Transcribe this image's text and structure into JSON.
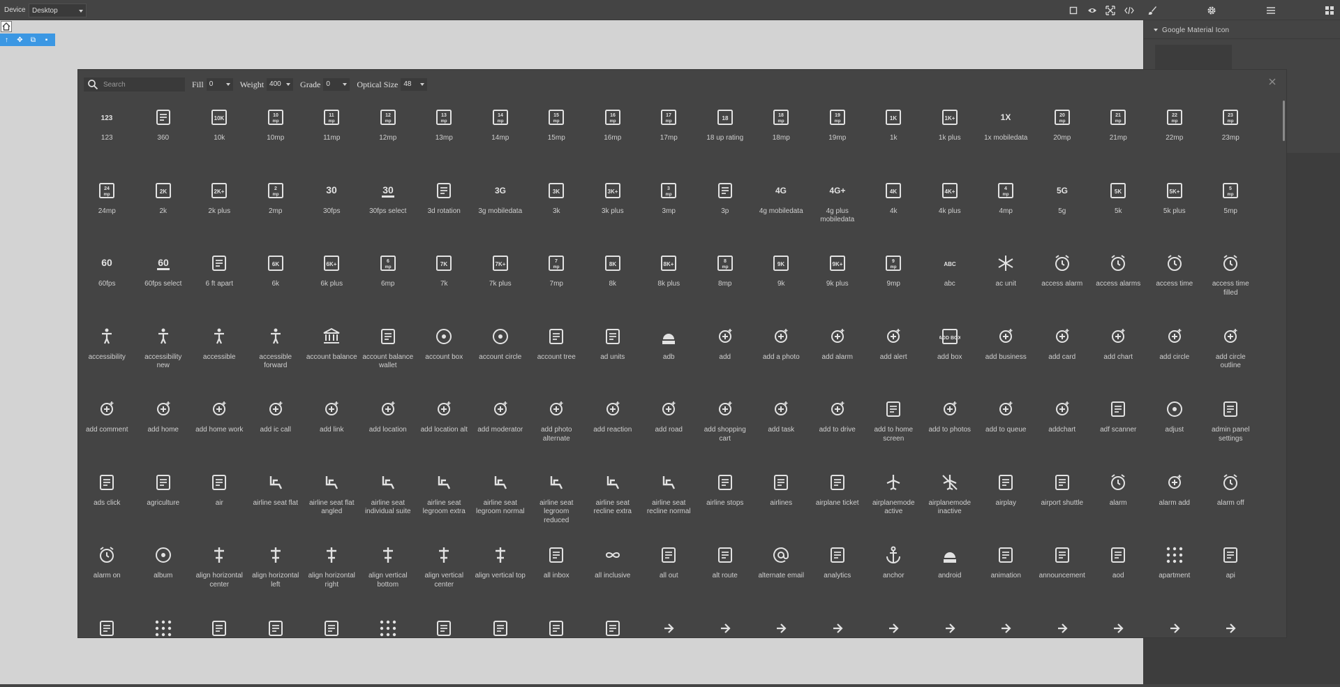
{
  "topbar": {
    "device_label": "Device",
    "device_value": "Desktop"
  },
  "panel": {
    "title": "Google Material Icon"
  },
  "picker": {
    "search_placeholder": "Search",
    "fill_label": "Fill",
    "fill_value": "0",
    "weight_label": "Weight",
    "weight_value": "400",
    "grade_label": "Grade",
    "grade_value": "0",
    "optical_label": "Optical Size",
    "optical_value": "48"
  },
  "icons": [
    {
      "label": "123",
      "icon": "num-123-icon"
    },
    {
      "label": "360",
      "icon": "rotate-360-icon"
    },
    {
      "label": "10k",
      "icon": "box-10k-icon"
    },
    {
      "label": "10mp",
      "icon": "mp-10-icon"
    },
    {
      "label": "11mp",
      "icon": "mp-11-icon"
    },
    {
      "label": "12mp",
      "icon": "mp-12-icon"
    },
    {
      "label": "13mp",
      "icon": "mp-13-icon"
    },
    {
      "label": "14mp",
      "icon": "mp-14-icon"
    },
    {
      "label": "15mp",
      "icon": "mp-15-icon"
    },
    {
      "label": "16mp",
      "icon": "mp-16-icon"
    },
    {
      "label": "17mp",
      "icon": "mp-17-icon"
    },
    {
      "label": "18 up rating",
      "icon": "rating-18-icon"
    },
    {
      "label": "18mp",
      "icon": "mp-18-icon"
    },
    {
      "label": "19mp",
      "icon": "mp-19-icon"
    },
    {
      "label": "1k",
      "icon": "box-1k-icon"
    },
    {
      "label": "1k plus",
      "icon": "box-1k-plus-icon"
    },
    {
      "label": "1x mobiledata",
      "icon": "mobiledata-1x-icon"
    },
    {
      "label": "20mp",
      "icon": "mp-20-icon"
    },
    {
      "label": "21mp",
      "icon": "mp-21-icon"
    },
    {
      "label": "22mp",
      "icon": "mp-22-icon"
    },
    {
      "label": "23mp",
      "icon": "mp-23-icon"
    },
    {
      "label": "24mp",
      "icon": "mp-24-icon"
    },
    {
      "label": "2k",
      "icon": "box-2k-icon"
    },
    {
      "label": "2k plus",
      "icon": "box-2k-plus-icon"
    },
    {
      "label": "2mp",
      "icon": "mp-2-icon"
    },
    {
      "label": "30fps",
      "icon": "fps-30-icon"
    },
    {
      "label": "30fps select",
      "icon": "fps-30-select-icon"
    },
    {
      "label": "3d rotation",
      "icon": "rotation-3d-icon"
    },
    {
      "label": "3g mobiledata",
      "icon": "mobiledata-3g-icon"
    },
    {
      "label": "3k",
      "icon": "box-3k-icon"
    },
    {
      "label": "3k plus",
      "icon": "box-3k-plus-icon"
    },
    {
      "label": "3mp",
      "icon": "mp-3-icon"
    },
    {
      "label": "3p",
      "icon": "chat-person-icon"
    },
    {
      "label": "4g mobiledata",
      "icon": "mobiledata-4g-icon"
    },
    {
      "label": "4g plus mobiledata",
      "icon": "mobiledata-4g-plus-icon"
    },
    {
      "label": "4k",
      "icon": "box-4k-icon"
    },
    {
      "label": "4k plus",
      "icon": "box-4k-plus-icon"
    },
    {
      "label": "4mp",
      "icon": "mp-4-icon"
    },
    {
      "label": "5g",
      "icon": "mobiledata-5g-icon"
    },
    {
      "label": "5k",
      "icon": "box-5k-icon"
    },
    {
      "label": "5k plus",
      "icon": "box-5k-plus-icon"
    },
    {
      "label": "5mp",
      "icon": "mp-5-icon"
    },
    {
      "label": "60fps",
      "icon": "fps-60-icon"
    },
    {
      "label": "60fps select",
      "icon": "fps-60-select-icon"
    },
    {
      "label": "6 ft apart",
      "icon": "distance-icon"
    },
    {
      "label": "6k",
      "icon": "box-6k-icon"
    },
    {
      "label": "6k plus",
      "icon": "box-6k-plus-icon"
    },
    {
      "label": "6mp",
      "icon": "mp-6-icon"
    },
    {
      "label": "7k",
      "icon": "box-7k-icon"
    },
    {
      "label": "7k plus",
      "icon": "box-7k-plus-icon"
    },
    {
      "label": "7mp",
      "icon": "mp-7-icon"
    },
    {
      "label": "8k",
      "icon": "box-8k-icon"
    },
    {
      "label": "8k plus",
      "icon": "box-8k-plus-icon"
    },
    {
      "label": "8mp",
      "icon": "mp-8-icon"
    },
    {
      "label": "9k",
      "icon": "box-9k-icon"
    },
    {
      "label": "9k plus",
      "icon": "box-9k-plus-icon"
    },
    {
      "label": "9mp",
      "icon": "mp-9-icon"
    },
    {
      "label": "abc",
      "icon": "abc-icon"
    },
    {
      "label": "ac unit",
      "icon": "snowflake-icon"
    },
    {
      "label": "access alarm",
      "icon": "alarm-clock-icon"
    },
    {
      "label": "access alarms",
      "icon": "alarm-clock-icon"
    },
    {
      "label": "access time",
      "icon": "clock-icon"
    },
    {
      "label": "access time filled",
      "icon": "clock-filled-icon"
    },
    {
      "label": "accessibility",
      "icon": "person-icon"
    },
    {
      "label": "accessibility new",
      "icon": "person-arms-icon"
    },
    {
      "label": "accessible",
      "icon": "wheelchair-icon"
    },
    {
      "label": "accessible forward",
      "icon": "wheelchair-forward-icon"
    },
    {
      "label": "account balance",
      "icon": "bank-icon"
    },
    {
      "label": "account balance wallet",
      "icon": "wallet-icon"
    },
    {
      "label": "account box",
      "icon": "account-box-icon"
    },
    {
      "label": "account circle",
      "icon": "account-circle-icon"
    },
    {
      "label": "account tree",
      "icon": "tree-icon"
    },
    {
      "label": "ad units",
      "icon": "phone-icon"
    },
    {
      "label": "adb",
      "icon": "adb-icon"
    },
    {
      "label": "add",
      "icon": "plus-icon"
    },
    {
      "label": "add a photo",
      "icon": "camera-plus-icon"
    },
    {
      "label": "add alarm",
      "icon": "alarm-plus-icon"
    },
    {
      "label": "add alert",
      "icon": "bell-plus-icon"
    },
    {
      "label": "add box",
      "icon": "box-plus-icon"
    },
    {
      "label": "add business",
      "icon": "store-plus-icon"
    },
    {
      "label": "add card",
      "icon": "card-plus-icon"
    },
    {
      "label": "add chart",
      "icon": "chart-plus-icon"
    },
    {
      "label": "add circle",
      "icon": "circle-plus-icon"
    },
    {
      "label": "add circle outline",
      "icon": "circle-plus-outline-icon"
    },
    {
      "label": "add comment",
      "icon": "comment-plus-icon"
    },
    {
      "label": "add home",
      "icon": "home-plus-icon"
    },
    {
      "label": "add home work",
      "icon": "home-work-plus-icon"
    },
    {
      "label": "add ic call",
      "icon": "phone-plus-icon"
    },
    {
      "label": "add link",
      "icon": "link-plus-icon"
    },
    {
      "label": "add location",
      "icon": "pin-plus-icon"
    },
    {
      "label": "add location alt",
      "icon": "pin-plus-alt-icon"
    },
    {
      "label": "add moderator",
      "icon": "shield-plus-icon"
    },
    {
      "label": "add photo alternate",
      "icon": "image-plus-icon"
    },
    {
      "label": "add reaction",
      "icon": "smile-plus-icon"
    },
    {
      "label": "add road",
      "icon": "road-plus-icon"
    },
    {
      "label": "add shopping cart",
      "icon": "cart-plus-icon"
    },
    {
      "label": "add task",
      "icon": "check-plus-icon"
    },
    {
      "label": "add to drive",
      "icon": "drive-plus-icon"
    },
    {
      "label": "add to home screen",
      "icon": "phone-arrow-icon"
    },
    {
      "label": "add to photos",
      "icon": "photos-plus-icon"
    },
    {
      "label": "add to queue",
      "icon": "monitor-plus-icon"
    },
    {
      "label": "addchart",
      "icon": "chart-plus-icon"
    },
    {
      "label": "adf scanner",
      "icon": "scanner-icon"
    },
    {
      "label": "adjust",
      "icon": "adjust-icon"
    },
    {
      "label": "admin panel settings",
      "icon": "shield-person-icon"
    },
    {
      "label": "ads click",
      "icon": "cursor-click-icon"
    },
    {
      "label": "agriculture",
      "icon": "tractor-icon"
    },
    {
      "label": "air",
      "icon": "wind-icon"
    },
    {
      "label": "airline seat flat",
      "icon": "seat-flat-icon"
    },
    {
      "label": "airline seat flat angled",
      "icon": "seat-angled-icon"
    },
    {
      "label": "airline seat individual suite",
      "icon": "seat-suite-icon"
    },
    {
      "label": "airline seat legroom extra",
      "icon": "seat-legroom-icon"
    },
    {
      "label": "airline seat legroom normal",
      "icon": "seat-legroom-icon"
    },
    {
      "label": "airline seat legroom reduced",
      "icon": "seat-legroom-icon"
    },
    {
      "label": "airline seat recline extra",
      "icon": "seat-recline-icon"
    },
    {
      "label": "airline seat recline normal",
      "icon": "seat-recline-icon"
    },
    {
      "label": "airline stops",
      "icon": "stops-icon"
    },
    {
      "label": "airlines",
      "icon": "airlines-icon"
    },
    {
      "label": "airplane ticket",
      "icon": "ticket-icon"
    },
    {
      "label": "airplanemode active",
      "icon": "plane-icon"
    },
    {
      "label": "airplanemode inactive",
      "icon": "plane-off-icon"
    },
    {
      "label": "airplay",
      "icon": "airplay-icon"
    },
    {
      "label": "airport shuttle",
      "icon": "shuttle-icon"
    },
    {
      "label": "alarm",
      "icon": "alarm-clock-icon"
    },
    {
      "label": "alarm add",
      "icon": "alarm-plus-icon"
    },
    {
      "label": "alarm off",
      "icon": "alarm-off-icon"
    },
    {
      "label": "alarm on",
      "icon": "alarm-check-icon"
    },
    {
      "label": "album",
      "icon": "album-icon"
    },
    {
      "label": "align horizontal center",
      "icon": "align-h-center-icon"
    },
    {
      "label": "align horizontal left",
      "icon": "align-h-left-icon"
    },
    {
      "label": "align horizontal right",
      "icon": "align-h-right-icon"
    },
    {
      "label": "align vertical bottom",
      "icon": "align-v-bottom-icon"
    },
    {
      "label": "align vertical center",
      "icon": "align-v-center-icon"
    },
    {
      "label": "align vertical top",
      "icon": "align-v-top-icon"
    },
    {
      "label": "all inbox",
      "icon": "inbox-icon"
    },
    {
      "label": "all inclusive",
      "icon": "infinity-icon"
    },
    {
      "label": "all out",
      "icon": "all-out-icon"
    },
    {
      "label": "alt route",
      "icon": "alt-route-icon"
    },
    {
      "label": "alternate email",
      "icon": "at-icon"
    },
    {
      "label": "analytics",
      "icon": "analytics-icon"
    },
    {
      "label": "anchor",
      "icon": "anchor-icon"
    },
    {
      "label": "android",
      "icon": "android-icon"
    },
    {
      "label": "animation",
      "icon": "animation-icon"
    },
    {
      "label": "announcement",
      "icon": "announcement-icon"
    },
    {
      "label": "aod",
      "icon": "aod-icon"
    },
    {
      "label": "apartment",
      "icon": "apartment-icon"
    },
    {
      "label": "api",
      "icon": "api-icon"
    },
    {
      "label": "",
      "icon": "app-blocking-icon"
    },
    {
      "label": "",
      "icon": "apps-edit-icon"
    },
    {
      "label": "",
      "icon": "app-settings-icon"
    },
    {
      "label": "",
      "icon": "app-shortcut-icon"
    },
    {
      "label": "",
      "icon": "approval-icon"
    },
    {
      "label": "",
      "icon": "apps-icon"
    },
    {
      "label": "",
      "icon": "apps-outage-icon"
    },
    {
      "label": "",
      "icon": "architecture-icon"
    },
    {
      "label": "",
      "icon": "archive-icon"
    },
    {
      "label": "",
      "icon": "area-chart-icon"
    },
    {
      "label": "",
      "icon": "arrow-back-icon"
    },
    {
      "label": "",
      "icon": "arrow-back-ios-icon"
    },
    {
      "label": "",
      "icon": "arrow-back-ios-new-icon"
    },
    {
      "label": "",
      "icon": "arrow-circle-down-icon"
    },
    {
      "label": "",
      "icon": "arrow-circle-left-icon"
    },
    {
      "label": "",
      "icon": "arrow-circle-right-icon"
    },
    {
      "label": "",
      "icon": "arrow-circle-up-icon"
    },
    {
      "label": "",
      "icon": "arrow-downward-icon"
    },
    {
      "label": "",
      "icon": "arrow-drop-down-icon"
    },
    {
      "label": "",
      "icon": "arrow-drop-down-circle-icon"
    },
    {
      "label": "",
      "icon": "arrow-drop-up-icon"
    }
  ]
}
